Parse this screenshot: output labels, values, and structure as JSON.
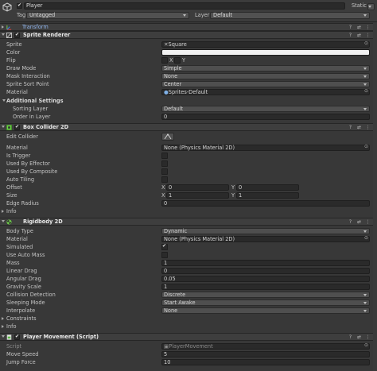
{
  "header": {
    "object_name": "Player",
    "static_label": "Static",
    "tag_label": "Tag",
    "tag_value": "Untagged",
    "layer_label": "Layer",
    "layer_value": "Default"
  },
  "transform": {
    "title": "Transform"
  },
  "sprite_renderer": {
    "title": "Sprite Renderer",
    "rows": {
      "sprite": {
        "label": "Sprite",
        "value": "Square"
      },
      "color": {
        "label": "Color"
      },
      "flip": {
        "label": "Flip",
        "x": "X",
        "y": "Y"
      },
      "draw_mode": {
        "label": "Draw Mode",
        "value": "Simple"
      },
      "mask_interaction": {
        "label": "Mask Interaction",
        "value": "None"
      },
      "sprite_sort_point": {
        "label": "Sprite Sort Point",
        "value": "Center"
      },
      "material": {
        "label": "Material",
        "value": "Sprites-Default"
      },
      "additional_settings": {
        "label": "Additional Settings"
      },
      "sorting_layer": {
        "label": "Sorting Layer",
        "value": "Default"
      },
      "order_in_layer": {
        "label": "Order in Layer",
        "value": "0"
      }
    }
  },
  "box_collider": {
    "title": "Box Collider 2D",
    "rows": {
      "edit_collider": {
        "label": "Edit Collider"
      },
      "material": {
        "label": "Material",
        "value": "None (Physics Material 2D)"
      },
      "is_trigger": {
        "label": "Is Trigger"
      },
      "used_by_effector": {
        "label": "Used By Effector"
      },
      "used_by_composite": {
        "label": "Used By Composite"
      },
      "auto_tiling": {
        "label": "Auto Tiling"
      },
      "offset": {
        "label": "Offset",
        "x_label": "X",
        "x": "0",
        "y_label": "Y",
        "y": "0"
      },
      "size": {
        "label": "Size",
        "x_label": "X",
        "x": "1",
        "y_label": "Y",
        "y": "1"
      },
      "edge_radius": {
        "label": "Edge Radius",
        "value": "0"
      },
      "info": {
        "label": "Info"
      }
    }
  },
  "rigidbody": {
    "title": "Rigidbody 2D",
    "rows": {
      "body_type": {
        "label": "Body Type",
        "value": "Dynamic"
      },
      "material": {
        "label": "Material",
        "value": "None (Physics Material 2D)"
      },
      "simulated": {
        "label": "Simulated"
      },
      "use_auto_mass": {
        "label": "Use Auto Mass"
      },
      "mass": {
        "label": "Mass",
        "value": "1"
      },
      "linear_drag": {
        "label": "Linear Drag",
        "value": "0"
      },
      "angular_drag": {
        "label": "Angular Drag",
        "value": "0.05"
      },
      "gravity_scale": {
        "label": "Gravity Scale",
        "value": "1"
      },
      "collision_detection": {
        "label": "Collision Detection",
        "value": "Discrete"
      },
      "sleeping_mode": {
        "label": "Sleeping Mode",
        "value": "Start Awake"
      },
      "interpolate": {
        "label": "Interpolate",
        "value": "None"
      },
      "constraints": {
        "label": "Constraints"
      },
      "info": {
        "label": "Info"
      }
    }
  },
  "player_movement": {
    "title": "Player Movement (Script)",
    "rows": {
      "script": {
        "label": "Script",
        "value": "PlayerMovement"
      },
      "move_speed": {
        "label": "Move Speed",
        "value": "5"
      },
      "jump_force": {
        "label": "Jump Force",
        "value": "10"
      }
    }
  },
  "icons": {
    "help": "?",
    "presets": "⇄",
    "menu": "⋮"
  }
}
